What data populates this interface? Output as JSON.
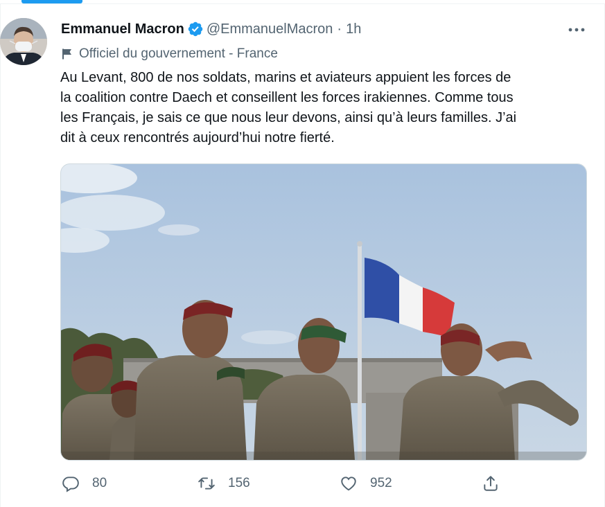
{
  "tweet": {
    "author": {
      "name": "Emmanuel Macron",
      "handle": "@EmmanuelMacron",
      "verified": true
    },
    "separator": "·",
    "time": "1h",
    "label": "Officiel du gouvernement - France",
    "text": "Au Levant, 800 de nos soldats, marins et aviateurs appuient les forces de\nla coalition contre Daech et conseillent les forces irakiennes. Comme tous\nles Français, je sais ce que nous leur devons, ainsi qu’à leurs familles. J’ai\ndit à ceux rencontrés aujourd’hui notre fierté.",
    "more_icon": "more-horizontal-icon",
    "label_icon": "flag-icon",
    "media": {
      "type": "photo"
    },
    "actions": {
      "replies": "80",
      "retweets": "156",
      "likes": "952"
    }
  },
  "colors": {
    "accent": "#1d9bf0",
    "secondary_text": "#536471",
    "primary_text": "#0f1419"
  }
}
